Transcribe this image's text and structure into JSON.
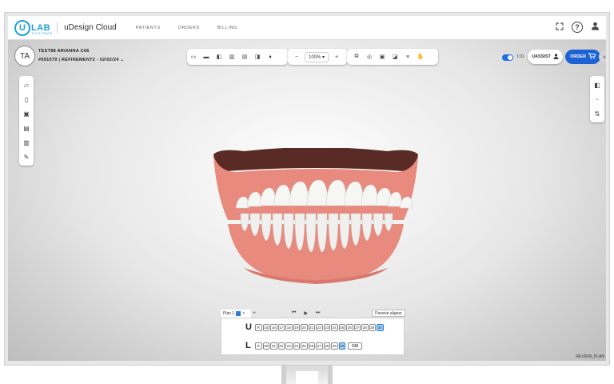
{
  "logo": {
    "mark": "U",
    "text": "LAB",
    "sub": "SYSTEMS"
  },
  "app_name": "uDesign Cloud",
  "nav": [
    "PATIENTS",
    "ORDERS",
    "BILLING"
  ],
  "top_icons": [
    "fullscreen-icon",
    "help-icon",
    "user-icon"
  ],
  "help_glyph": "?",
  "patient": {
    "initials": "TA",
    "name": "TEST88 ARIANNA C66",
    "case": "#591079 | REFINEMENT2 - 02/02/24"
  },
  "toolbar": {
    "views": [
      "front-view-icon",
      "occlusal-view-icon",
      "left-view-icon",
      "right-view-icon",
      "upper-view-icon",
      "lower-view-icon",
      "tooth-icon"
    ],
    "zoom_minus": "−",
    "zoom": "100%",
    "zoom_plus": "+",
    "tools": [
      "compare-icon",
      "overlay-icon",
      "attachment-icon",
      "ipr-icon",
      "grid-icon",
      "hand-icon"
    ]
  },
  "right_controls": {
    "ratio": "1:01",
    "uassist_label": "UASSIST",
    "order_label": "ORDER",
    "close": "×"
  },
  "left_tools": [
    "notes-icon",
    "document-icon",
    "image-icon",
    "clipboard-icon",
    "table-icon",
    "pencil-icon"
  ],
  "right_tools": [
    "layers-icon",
    "teeth-icon",
    "swap-icon"
  ],
  "plan": {
    "tab_label": "Plan 1",
    "tab_close": "×",
    "add": "+",
    "passive_aligner": "Passive aligner",
    "upper_label": "U",
    "lower_label": "L",
    "upper_stages": [
      "R",
      "15",
      "16",
      "17",
      "18",
      "19",
      "20",
      "21",
      "22",
      "23",
      "24",
      "25",
      "26",
      "27",
      "28",
      "29",
      "30"
    ],
    "lower_stages": [
      "R",
      "20",
      "21",
      "22",
      "23",
      "24",
      "25",
      "26",
      "27",
      "28",
      "29",
      "30"
    ],
    "upper_active": "30",
    "lower_active": "30",
    "gm_label": "GM"
  },
  "watermark": "REVIEW_PLAN",
  "colors": {
    "accent": "#1e63d6",
    "logo": "#1ea0d6",
    "gum": "#e88a7d"
  }
}
